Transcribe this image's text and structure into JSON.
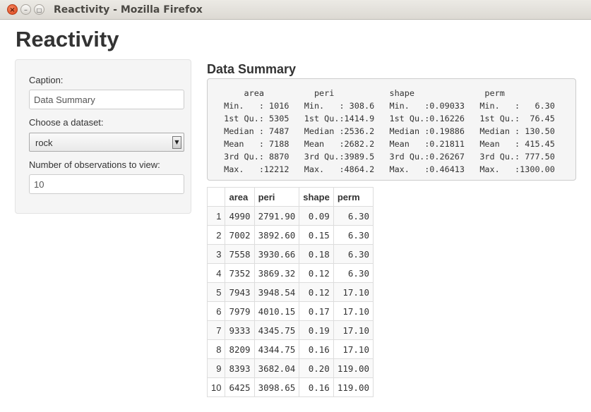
{
  "window": {
    "title": "Reactivity - Mozilla Firefox"
  },
  "page": {
    "title": "Reactivity"
  },
  "sidebar": {
    "caption_label": "Caption:",
    "caption_value": "Data Summary",
    "dataset_label": "Choose a dataset:",
    "dataset_value": "rock",
    "obs_label": "Number of observations to view:",
    "obs_value": "10"
  },
  "main": {
    "summary_title": "Data Summary",
    "summary_text": "     area          peri           shape              perm        \n Min.   : 1016   Min.   : 308.6   Min.   :0.09033   Min.   :   6.30  \n 1st Qu.: 5305   1st Qu.:1414.9   1st Qu.:0.16226   1st Qu.:  76.45  \n Median : 7487   Median :2536.2   Median :0.19886   Median : 130.50  \n Mean   : 7188   Mean   :2682.2   Mean   :0.21811   Mean   : 415.45  \n 3rd Qu.: 8870   3rd Qu.:3989.5   3rd Qu.:0.26267   3rd Qu.: 777.50  \n Max.   :12212   Max.   :4864.2   Max.   :0.46413   Max.   :1300.00  ",
    "table": {
      "headers": [
        "",
        "area",
        "peri",
        "shape",
        "perm"
      ],
      "rows": [
        [
          "1",
          "4990",
          "2791.90",
          "0.09",
          "6.30"
        ],
        [
          "2",
          "7002",
          "3892.60",
          "0.15",
          "6.30"
        ],
        [
          "3",
          "7558",
          "3930.66",
          "0.18",
          "6.30"
        ],
        [
          "4",
          "7352",
          "3869.32",
          "0.12",
          "6.30"
        ],
        [
          "5",
          "7943",
          "3948.54",
          "0.12",
          "17.10"
        ],
        [
          "6",
          "7979",
          "4010.15",
          "0.17",
          "17.10"
        ],
        [
          "7",
          "9333",
          "4345.75",
          "0.19",
          "17.10"
        ],
        [
          "8",
          "8209",
          "4344.75",
          "0.16",
          "17.10"
        ],
        [
          "9",
          "8393",
          "3682.04",
          "0.20",
          "119.00"
        ],
        [
          "10",
          "6425",
          "3098.65",
          "0.16",
          "119.00"
        ]
      ]
    }
  }
}
